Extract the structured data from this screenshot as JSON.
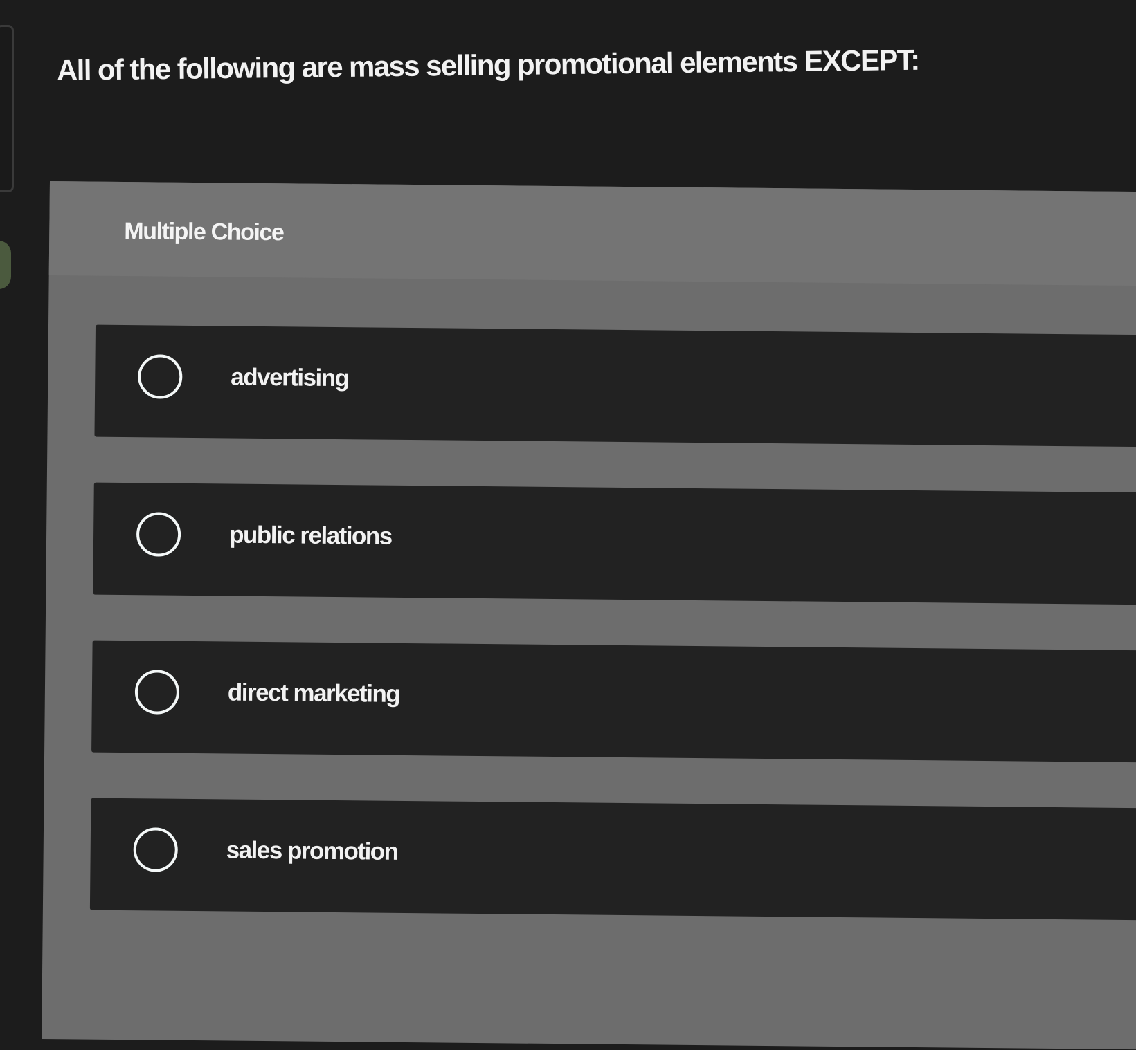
{
  "question": {
    "text": "All of the following are mass selling promotional elements EXCEPT:"
  },
  "question_type": "Multiple Choice",
  "options": [
    {
      "label": "advertising",
      "selected": false
    },
    {
      "label": "public relations",
      "selected": false
    },
    {
      "label": "direct marketing",
      "selected": false
    },
    {
      "label": "sales promotion",
      "selected": false
    }
  ],
  "colors": {
    "background": "#1c1c1c",
    "panel": "#6d6d6d",
    "option_row": "#222222",
    "text": "#f2f2f2"
  }
}
